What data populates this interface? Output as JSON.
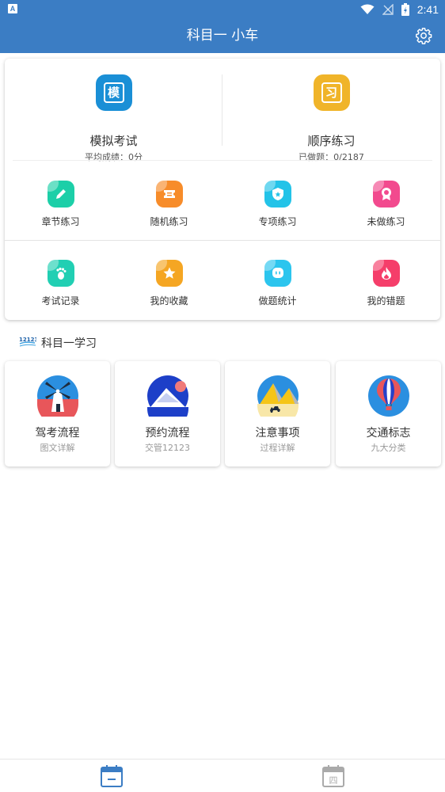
{
  "status_bar": {
    "notification_icon": "A",
    "icons": [
      "wifi-icon",
      "signal-off-icon",
      "battery-charging-icon"
    ],
    "time": "2:41"
  },
  "app_bar": {
    "title": "科目一 小车",
    "settings_icon": "gear-icon"
  },
  "main_card": {
    "primary": [
      {
        "label": "模拟考试",
        "sub": "平均成绩：0分",
        "glyph": "模",
        "color": "#1a8fd6"
      },
      {
        "label": "顺序练习",
        "sub": "已做题：0/2187",
        "glyph": "习",
        "color": "#f0b429"
      }
    ],
    "row1": [
      {
        "label": "章节练习",
        "icon": "pencil-icon",
        "color": "#1ccfa8"
      },
      {
        "label": "随机练习",
        "icon": "ticket-icon",
        "color": "#f78c2a"
      },
      {
        "label": "专项练习",
        "icon": "shield-icon",
        "color": "#23c3e8"
      },
      {
        "label": "未做练习",
        "icon": "ribbon-icon",
        "color": "#f24a8e"
      }
    ],
    "row2": [
      {
        "label": "考试记录",
        "icon": "footprint-icon",
        "color": "#21cfb3"
      },
      {
        "label": "我的收藏",
        "icon": "star-icon",
        "color": "#f5a623"
      },
      {
        "label": "做题统计",
        "icon": "chat-icon",
        "color": "#2cc5ee"
      },
      {
        "label": "我的错题",
        "icon": "flame-icon",
        "color": "#f53e6a"
      }
    ]
  },
  "study_section": {
    "logo_text": "12123",
    "title": "科目一学习",
    "tiles": [
      {
        "label": "驾考流程",
        "sub": "图文详解",
        "icon": "windmill-icon"
      },
      {
        "label": "预约流程",
        "sub": "交管12123",
        "icon": "mountain-icon"
      },
      {
        "label": "注意事项",
        "sub": "过程详解",
        "icon": "pyramid-icon"
      },
      {
        "label": "交通标志",
        "sub": "九大分类",
        "icon": "balloon-icon"
      }
    ]
  },
  "bottom_nav": {
    "items": [
      {
        "icon": "calendar-one-icon",
        "active": true,
        "color": "#3b7dc4"
      },
      {
        "icon": "calendar-four-icon",
        "active": false,
        "color": "#aaaaaa",
        "glyph": "四"
      }
    ]
  }
}
